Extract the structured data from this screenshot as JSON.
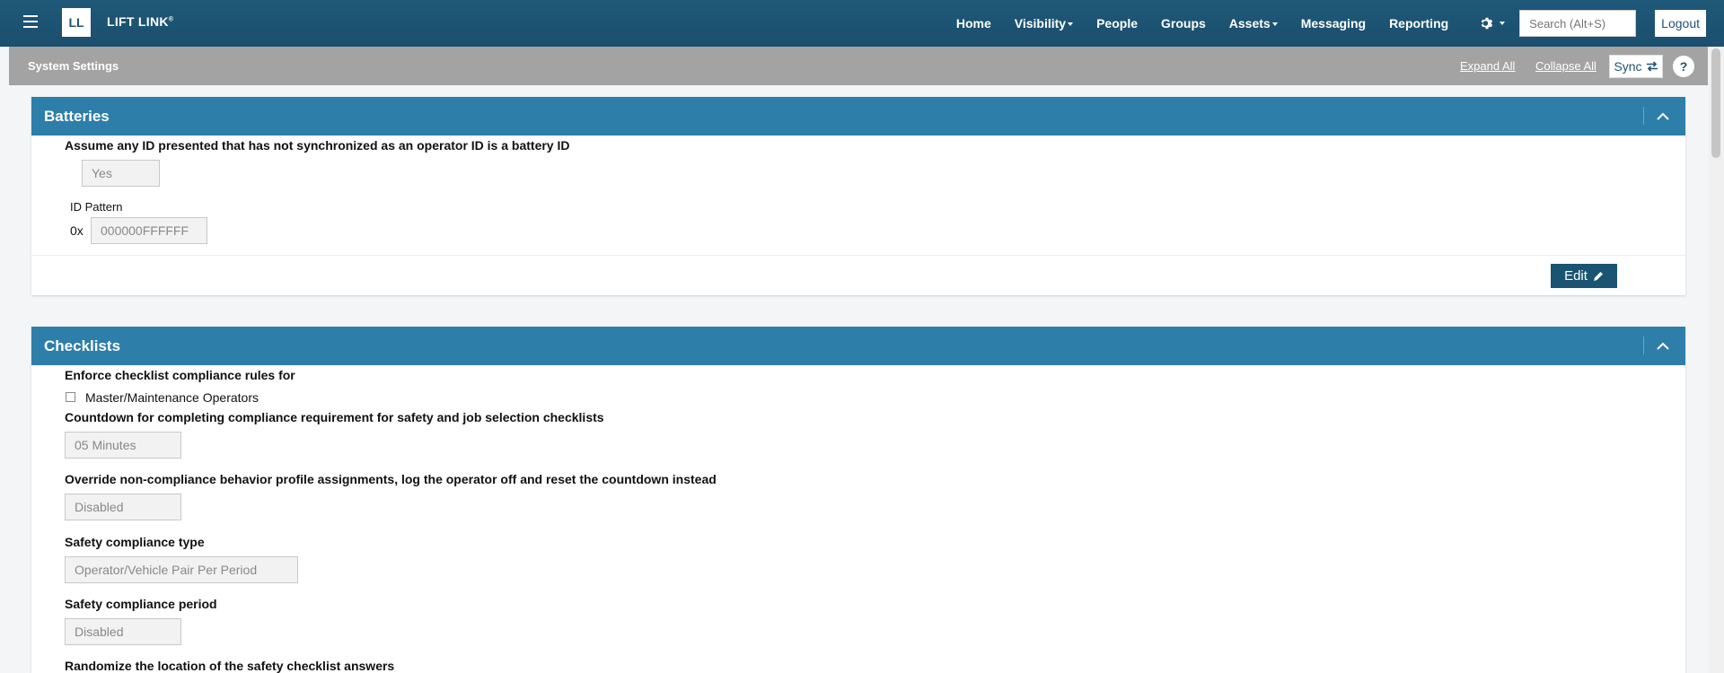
{
  "nav": {
    "logo_initials": "LL",
    "brand": "LIFT LINK",
    "brand_mark": "®",
    "links": {
      "home": "Home",
      "visibility": "Visibility",
      "people": "People",
      "groups": "Groups",
      "assets": "Assets",
      "messaging": "Messaging",
      "reporting": "Reporting"
    },
    "search_placeholder": "Search (Alt+S)",
    "logout": "Logout"
  },
  "subheader": {
    "title": "System Settings",
    "expand_all": "Expand All",
    "collapse_all": "Collapse All",
    "sync": "Sync",
    "help": "?"
  },
  "batteries": {
    "title": "Batteries",
    "assume_label": "Assume any ID presented that has not synchronized as an operator ID is a battery ID",
    "assume_value": "Yes",
    "id_pattern_label": "ID Pattern",
    "id_prefix": "0x",
    "id_pattern_value": "000000FFFFFF",
    "edit": "Edit"
  },
  "checklists": {
    "title": "Checklists",
    "enforce_label": "Enforce checklist compliance rules for",
    "master_operators_label": "Master/Maintenance Operators",
    "countdown_label": "Countdown for completing compliance requirement for safety and job selection checklists",
    "countdown_value": "05 Minutes",
    "override_label": "Override non-compliance behavior profile assignments, log the operator off and reset the countdown instead",
    "override_value": "Disabled",
    "safety_type_label": "Safety compliance type",
    "safety_type_value": "Operator/Vehicle Pair Per Period",
    "safety_period_label": "Safety compliance period",
    "safety_period_value": "Disabled",
    "randomize_label": "Randomize the location of the safety checklist answers"
  },
  "colors": {
    "navbar": "#1d5373",
    "panel_header": "#2d7ea9",
    "subheader": "#a3a3a3",
    "edit_button": "#1b5473"
  }
}
